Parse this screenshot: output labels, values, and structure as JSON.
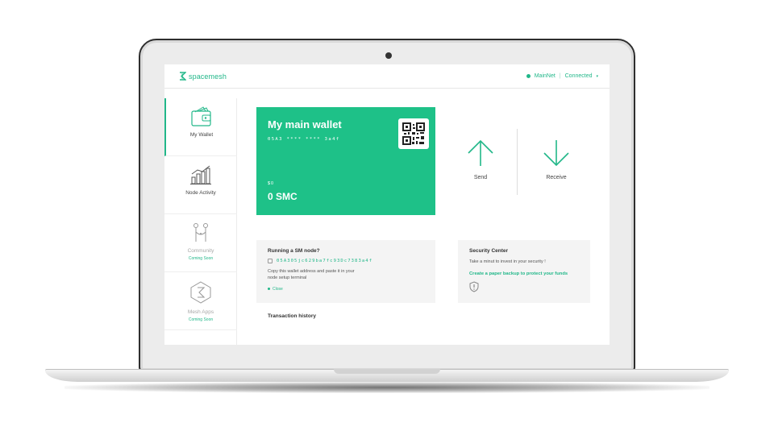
{
  "header": {
    "brand": "spacemesh",
    "network": "MainNet",
    "separator": "|",
    "connection": "Connected",
    "chevron": "▾"
  },
  "sidebar": {
    "items": [
      {
        "label": "My Wallet",
        "icon": "wallet-icon",
        "active": true,
        "coming_soon": ""
      },
      {
        "label": "Node Activity",
        "icon": "bar-chart-icon",
        "active": false,
        "coming_soon": ""
      },
      {
        "label": "Community",
        "icon": "community-icon",
        "active": false,
        "coming_soon": "Coming Soon"
      },
      {
        "label": "Mesh Apps",
        "icon": "mesh-apps-icon",
        "active": false,
        "coming_soon": "Coming Soon"
      }
    ]
  },
  "wallet": {
    "title": "My main wallet",
    "address": "05A3 **** **** 3a4f",
    "usd_value": "$0",
    "balance": "0 SMC",
    "qr_icon": "qr-code-icon"
  },
  "actions": {
    "send_label": "Send",
    "receive_label": "Receive"
  },
  "node_panel": {
    "title": "Running a SM node?",
    "address": "05A305jc629ba7fc93Dc7383a4f",
    "description": "Copy this wallet address and paste it in your node setup terminal",
    "close_label": "Close"
  },
  "security": {
    "title": "Security Center",
    "text": "Take a minut to invest in your security !",
    "link": "Create a paper backup to protect your funds"
  },
  "transactions": {
    "title": "Transaction history"
  },
  "colors": {
    "accent": "#21b789",
    "card": "#1ec188",
    "panel": "#f4f4f4"
  }
}
